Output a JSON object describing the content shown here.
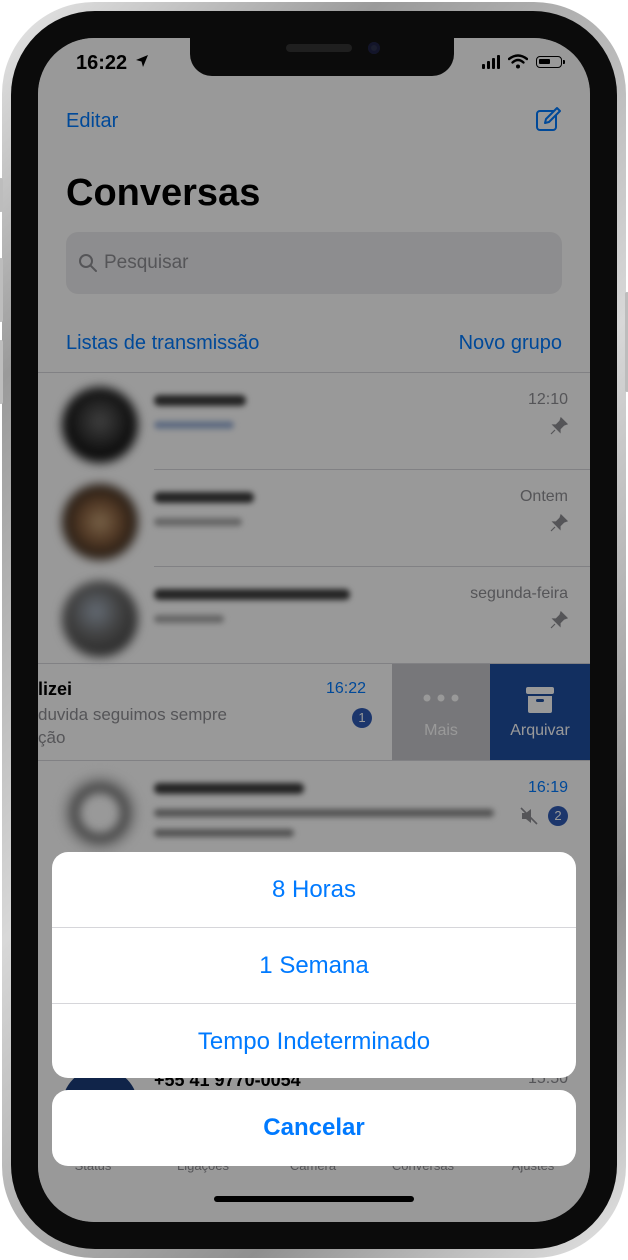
{
  "status_bar": {
    "time": "16:22"
  },
  "header": {
    "edit_label": "Editar",
    "title": "Conversas"
  },
  "search": {
    "placeholder": "Pesquisar"
  },
  "links": {
    "broadcast_lists": "Listas de transmissão",
    "new_group": "Novo grupo"
  },
  "chats": [
    {
      "time": "12:10",
      "pinned": true
    },
    {
      "time": "Ontem",
      "pinned": true
    },
    {
      "time": "segunda-feira",
      "pinned": true
    },
    {
      "name": "lizei",
      "preview_line1": "duvida seguimos sempre",
      "preview_line2": "ção",
      "time": "16:22",
      "unread": "1"
    },
    {
      "time": "16:19",
      "muted": true,
      "unread": "2"
    },
    {
      "name": "+55 41 9770-0054",
      "time": "15:50"
    }
  ],
  "swipe_actions": {
    "more_label": "Mais",
    "archive_label": "Arquivar"
  },
  "action_sheet": {
    "options": [
      "8 Horas",
      "1 Semana",
      "Tempo Indeterminado"
    ],
    "cancel_label": "Cancelar"
  },
  "tab_bar": {
    "items": [
      "Status",
      "Ligações",
      "Câmera",
      "Conversas",
      "Ajustes"
    ]
  },
  "colors": {
    "accent": "#007aff",
    "archive_bg": "#1f4fa0",
    "more_bg": "#c7c7cc",
    "badge": "#2f5bb5"
  },
  "icons": [
    "location-arrow-icon",
    "signal-icon",
    "wifi-icon",
    "battery-icon",
    "compose-icon",
    "search-icon",
    "pin-icon",
    "ellipsis-icon",
    "archive-icon",
    "mute-icon"
  ]
}
